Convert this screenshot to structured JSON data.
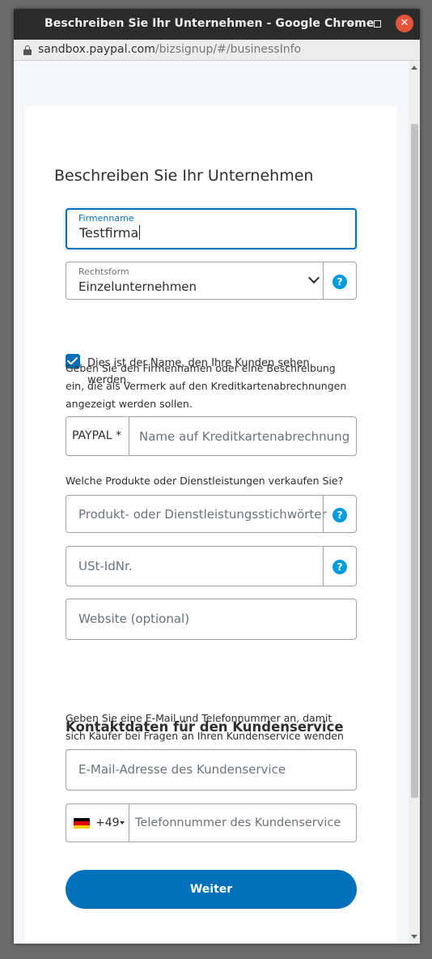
{
  "window": {
    "title": "Beschreiben Sie Ihr Unternehmen - Google Chrome",
    "minimize": "–",
    "close": "✕"
  },
  "urlbar": {
    "host": "sandbox.paypal.com",
    "path": "/bizsignup/#/businessInfo"
  },
  "form": {
    "heading": "Beschreiben Sie Ihr Unternehmen",
    "company": {
      "label": "Firmenname",
      "value": "Testfirma"
    },
    "legal_form": {
      "label": "Rechtsform",
      "value": "Einzelunternehmen",
      "help": "?"
    },
    "checkbox": {
      "checked": true,
      "label": "Dies ist der Name, den Ihre Kunden sehen werden."
    },
    "statement_info": "Geben Sie den Firmennamen oder eine Beschreibung ein, die als Vermerk auf den Kreditkartenabrechnungen angezeigt werden sollen.",
    "statement": {
      "prefix": "PAYPAL *",
      "placeholder": "Name auf Kreditkartenabrechnung"
    },
    "products_question": "Welche Produkte oder Dienstleistungen verkaufen Sie?",
    "products": {
      "placeholder": "Produkt- oder Dienstleistungsstichwörter",
      "help": "?"
    },
    "vat": {
      "placeholder": "USt-IdNr.",
      "help": "?"
    },
    "website": {
      "placeholder": "Website (optional)"
    }
  },
  "contact": {
    "heading": "Kontaktdaten für den Kundenservice",
    "info": "Geben Sie eine E-Mail und Telefonnummer an, damit sich Käufer bei Fragen an Ihren Kundenservice wenden können.",
    "email": {
      "placeholder": "E-Mail-Adresse des Kundenservice"
    },
    "phone": {
      "country": "Germany",
      "country_code": "+49",
      "placeholder": "Telefonnummer des Kundenservice"
    }
  },
  "submit_label": "Weiter",
  "colors": {
    "brand_blue": "#0070ba",
    "help_blue": "#009cde",
    "titlebar": "#2b2b2b",
    "close_button": "#e2553a"
  }
}
